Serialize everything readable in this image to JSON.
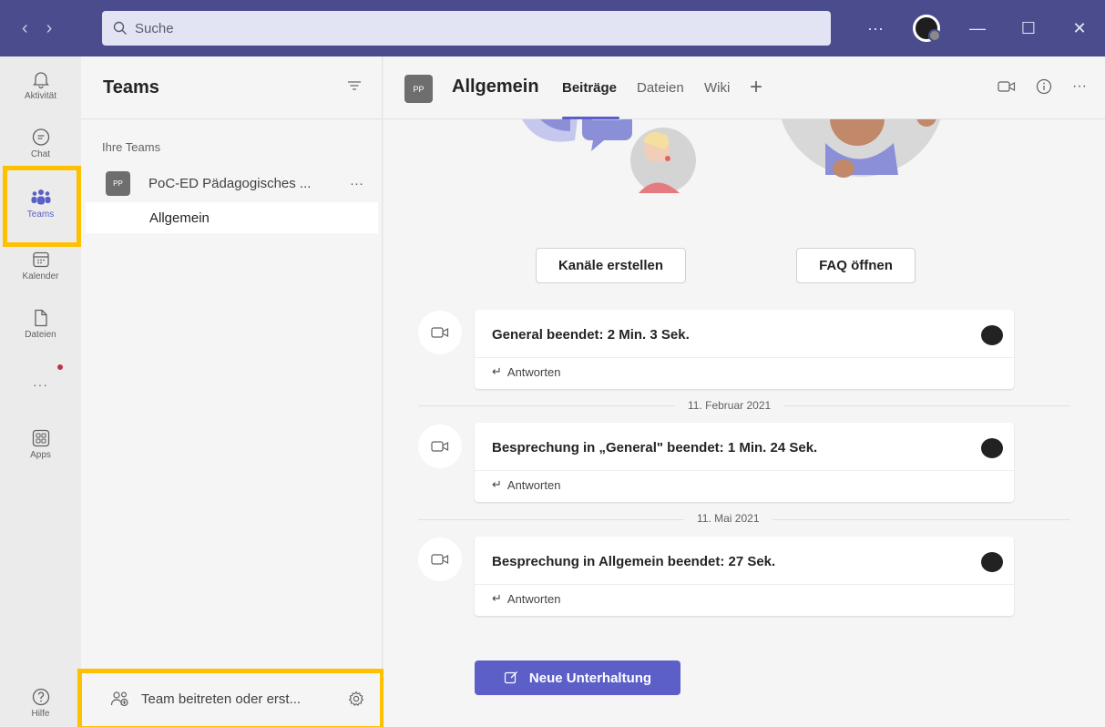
{
  "titlebar": {
    "search_placeholder": "Suche",
    "more_label": "···"
  },
  "rail": {
    "items": [
      {
        "label": "Aktivität",
        "icon": "bell-icon"
      },
      {
        "label": "Chat",
        "icon": "chat-icon"
      },
      {
        "label": "Teams",
        "icon": "teams-icon"
      },
      {
        "label": "Kalender",
        "icon": "calendar-icon"
      },
      {
        "label": "Dateien",
        "icon": "file-icon"
      },
      {
        "label": "···",
        "icon": "more-icon"
      },
      {
        "label": "Apps",
        "icon": "apps-icon"
      },
      {
        "label": "Hilfe",
        "icon": "help-icon"
      }
    ]
  },
  "panel": {
    "title": "Teams",
    "section_label": "Ihre Teams",
    "team": {
      "avatar": "PP",
      "name": "PoC-ED Pädagogisches ...",
      "more": "···"
    },
    "channel": "Allgemein",
    "join_label": "Team beitreten oder erst..."
  },
  "main": {
    "channel_avatar": "PP",
    "channel_title": "Allgemein",
    "tabs": [
      {
        "label": "Beiträge",
        "active": true
      },
      {
        "label": "Dateien",
        "active": false
      },
      {
        "label": "Wiki",
        "active": false
      }
    ],
    "add_tab": "+",
    "buttons": {
      "create_channels": "Kanäle erstellen",
      "open_faq": "FAQ öffnen"
    },
    "messages": [
      {
        "title": "General beendet: 2 Min. 3 Sek.",
        "reply": "Antworten"
      },
      {
        "title": "Besprechung in „General\" beendet: 1 Min. 24 Sek.",
        "reply": "Antworten"
      },
      {
        "title": "Besprechung in Allgemein beendet: 27 Sek.",
        "reply": "Antworten"
      }
    ],
    "dates": [
      "11. Februar 2021",
      "11. Mai 2021"
    ],
    "new_conversation": "Neue Unterhaltung"
  },
  "colors": {
    "titlebar": "#4a4c8e",
    "accent": "#5b5fc7",
    "highlight": "#ffc000"
  }
}
